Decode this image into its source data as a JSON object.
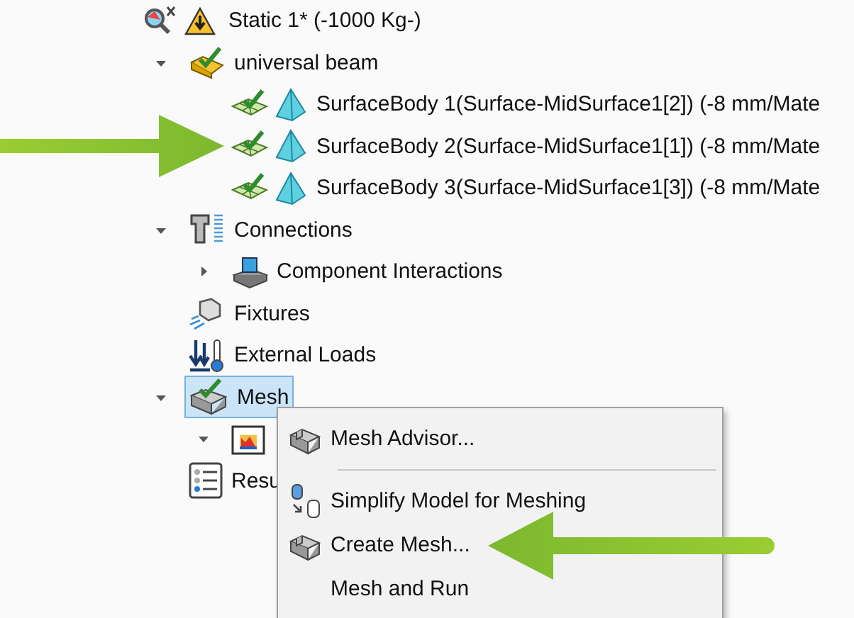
{
  "tree": [
    {
      "label": "Static 1* (-1000 Kg-)",
      "kind": "study",
      "warning": true,
      "selected": false,
      "children": [
        {
          "label": "universal beam",
          "kind": "part",
          "expanded": true,
          "selected": false,
          "children": [
            {
              "label": "SurfaceBody 1(Surface-MidSurface1[2]) (-8 mm/Mate",
              "kind": "body",
              "selected": false,
              "callout": false
            },
            {
              "label": "SurfaceBody 2(Surface-MidSurface1[1]) (-8 mm/Mate",
              "kind": "body",
              "selected": false,
              "callout": true
            },
            {
              "label": "SurfaceBody 3(Surface-MidSurface1[3]) (-8 mm/Mate",
              "kind": "body",
              "selected": false,
              "callout": false
            }
          ]
        },
        {
          "label": "Connections",
          "kind": "connections",
          "expanded": true,
          "selected": false,
          "children": [
            {
              "label": "Component Interactions",
              "kind": "interactions",
              "expanded": false,
              "selected": false
            }
          ]
        },
        {
          "label": "Fixtures",
          "kind": "fixtures",
          "selected": false
        },
        {
          "label": "External Loads",
          "kind": "loads",
          "selected": false
        },
        {
          "label": "Mesh",
          "kind": "mesh",
          "expanded": true,
          "selected": true,
          "children": [
            {
              "kind": "folder",
              "expanded": true,
              "selected": false
            }
          ]
        },
        {
          "label": "Resu",
          "kind": "results",
          "selected": false
        }
      ]
    }
  ],
  "context_menu": [
    {
      "label": "Mesh Advisor...",
      "kind": "mesh",
      "callout": false
    },
    {
      "kind": "separator"
    },
    {
      "label": "Simplify Model for Meshing",
      "kind": "simplify",
      "callout": false
    },
    {
      "label": "Create Mesh...",
      "kind": "mesh",
      "callout": true
    },
    {
      "label": "Mesh and Run",
      "kind": "none",
      "callout": false
    }
  ]
}
